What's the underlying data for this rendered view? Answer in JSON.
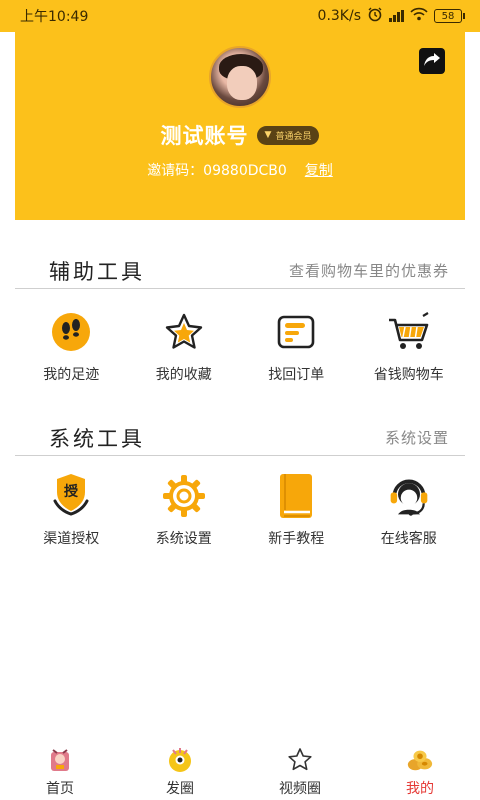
{
  "status_bar": {
    "time": "上午10:49",
    "speed": "0.3K/s",
    "battery": "58"
  },
  "profile": {
    "name": "测试账号",
    "member_badge": "普通会员",
    "invite_label": "邀请码：09880DCB0",
    "copy_label": "复制"
  },
  "assist_tools": {
    "title": "辅助工具",
    "link": "查看购物车里的优惠券",
    "items": [
      {
        "label": "我的足迹",
        "icon": "footprint-icon"
      },
      {
        "label": "我的收藏",
        "icon": "star-icon"
      },
      {
        "label": "找回订单",
        "icon": "order-icon"
      },
      {
        "label": "省钱购物车",
        "icon": "cart-icon"
      }
    ]
  },
  "system_tools": {
    "title": "系统工具",
    "link": "系统设置",
    "items": [
      {
        "label": "渠道授权",
        "icon": "authorize-icon"
      },
      {
        "label": "系统设置",
        "icon": "gear-icon"
      },
      {
        "label": "新手教程",
        "icon": "book-icon"
      },
      {
        "label": "在线客服",
        "icon": "customer-service-icon"
      }
    ]
  },
  "bottom_nav": {
    "items": [
      {
        "label": "首页",
        "icon": "home-icon"
      },
      {
        "label": "发圈",
        "icon": "post-icon"
      },
      {
        "label": "视频圈",
        "icon": "video-star-icon"
      },
      {
        "label": "我的",
        "icon": "me-icon"
      }
    ],
    "active": "我的"
  },
  "colors": {
    "brand_yellow": "#fcc11b",
    "icon_orange": "#f7a70a",
    "active_red": "#e53935"
  }
}
